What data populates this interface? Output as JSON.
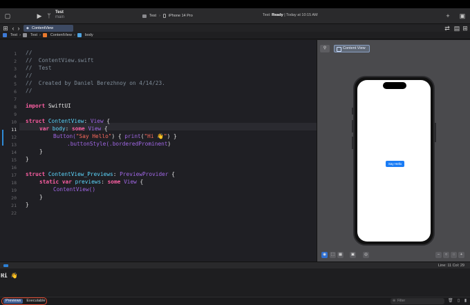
{
  "toolbar": {
    "project_name": "Test",
    "branch": "main",
    "scheme": "Test",
    "device": "iPhone 14 Pro",
    "status_prefix": "Test:",
    "status_state": "Ready",
    "status_time": "| Today at 10:15 AM"
  },
  "tab": {
    "label": "ContentView"
  },
  "breadcrumb": [
    "Test",
    "Test",
    "ContentView",
    "body"
  ],
  "editor": {
    "line_numbers": [
      "1",
      "2",
      "3",
      "4",
      "5",
      "6",
      "7",
      "8",
      "9",
      "10",
      "11",
      "12",
      "13",
      "14",
      "15",
      "16",
      "17",
      "18",
      "19",
      "20",
      "21",
      "22"
    ],
    "current_line": "11",
    "lines": {
      "l1": "//",
      "l2": "//  ContentView.swift",
      "l3": "//  Test",
      "l4": "//",
      "l5": "//  Created by Daniel Berezhnoy on 4/14/23.",
      "l6": "//",
      "l8_kw": "import",
      "l8_mod": " SwiftUI",
      "l10_kw": "struct",
      "l10_name": " ContentView",
      "l10_rest": ": ",
      "l10_type": "View",
      "l10_end": " {",
      "l11_kw": "var",
      "l11_name": " body",
      "l11_sep": ": ",
      "l11_kw2": "some",
      "l11_type": " View",
      "l11_end": " {",
      "l12_a": "Button(",
      "l12_str": "\"Say Hello\"",
      "l12_b": ") { ",
      "l12_fn": "print",
      "l12_c": "(",
      "l12_str2": "\"Hi 👋\"",
      "l12_d": ") }",
      "l13_a": ".buttonStyle(",
      "l13_b": ".borderedProminent",
      "l13_c": ")",
      "l14": "}",
      "l15": "}",
      "l17_kw": "struct",
      "l17_name": " ContentView_Previews",
      "l17_sep": ": ",
      "l17_type": "PreviewProvider",
      "l17_end": " {",
      "l18_kw": "static var",
      "l18_name": " previews",
      "l18_sep": ": ",
      "l18_kw2": "some",
      "l18_type": " View",
      "l18_end": " {",
      "l19": "ContentView()",
      "l20": "}",
      "l21": "}"
    }
  },
  "canvas": {
    "preview_tag": "Content View",
    "button_label": "Say Hello"
  },
  "debug": {
    "line_col": "Line: 11  Col: 29",
    "console_output": "Hi 👋"
  },
  "bottom": {
    "segments": [
      "Previews",
      "Executable"
    ],
    "active_segment": "Previews",
    "filter_placeholder": "Filter"
  },
  "colors": {
    "accent": "#1a7cf5",
    "highlight_ring": "#e14a30",
    "keyword": "#fc5fa3",
    "string": "#fc6a5d",
    "comment": "#7f8c98"
  }
}
